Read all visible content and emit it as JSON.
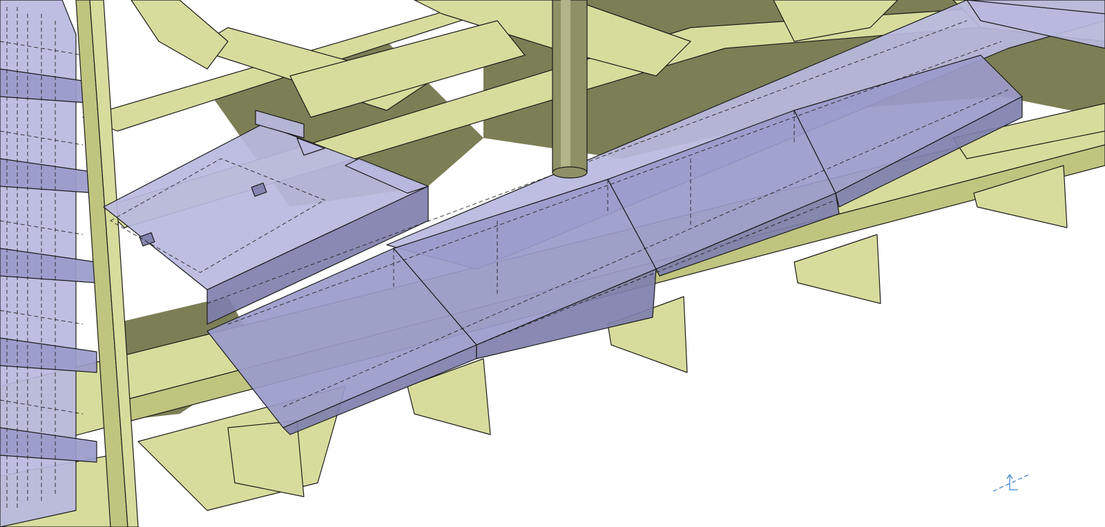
{
  "viewport": {
    "background": "#ffffff",
    "colors": {
      "floor_structure": "#d7dc9c",
      "floor_shadow": "#7c7f55",
      "selected_part": "#b9b9e0",
      "selected_part_dark": "#7f7fae",
      "hidden_lines": "#1a1a1a",
      "compass": "#2f7fd4"
    },
    "icons": {
      "compass": "axis-compass-icon"
    }
  }
}
